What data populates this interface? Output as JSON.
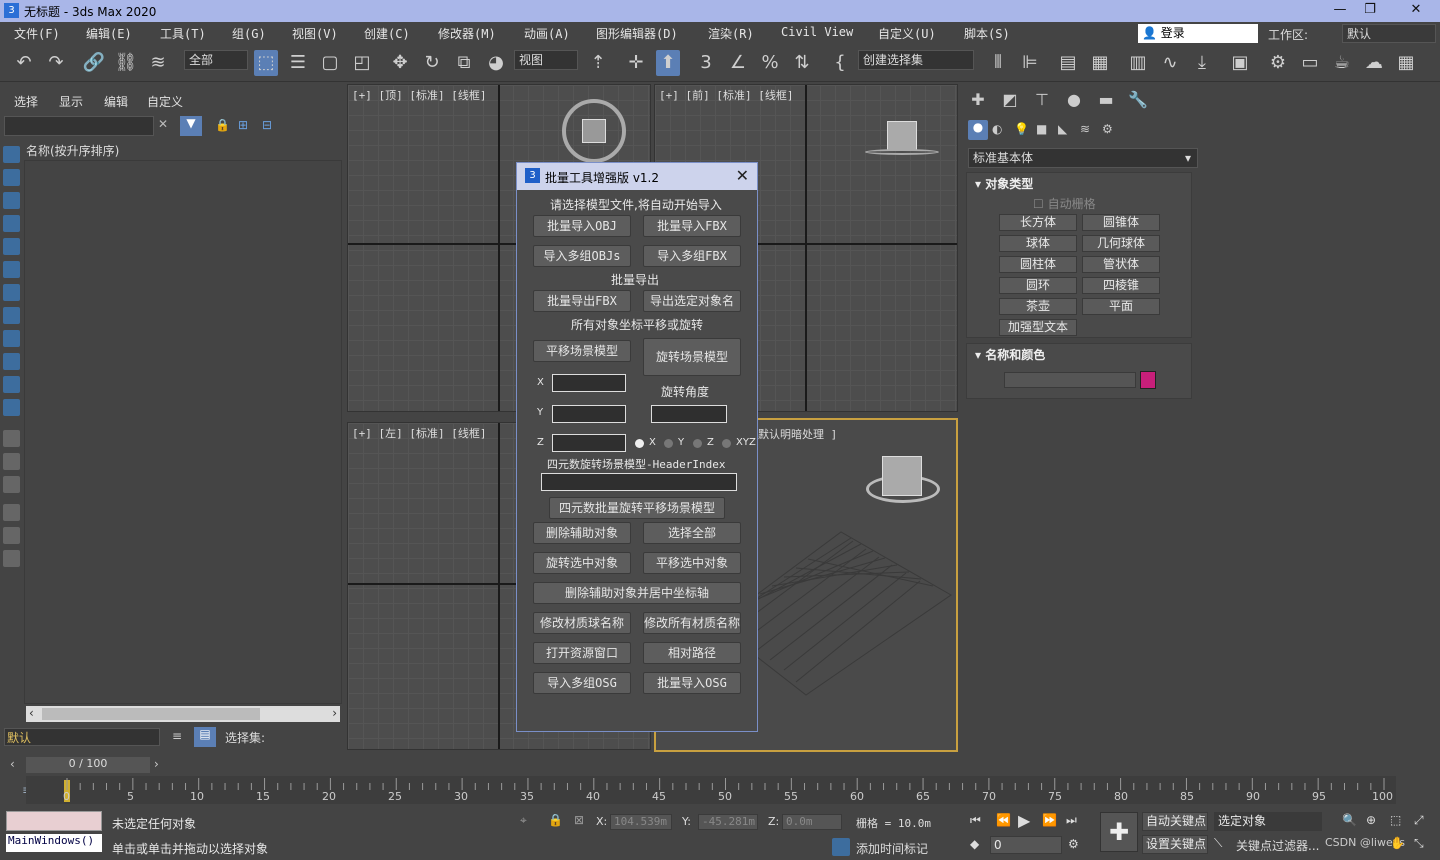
{
  "window": {
    "title": "无标题 - 3ds Max 2020",
    "min": "—",
    "max": "❐",
    "close": "✕"
  },
  "menu": [
    "文件(F)",
    "编辑(E)",
    "工具(T)",
    "组(G)",
    "视图(V)",
    "创建(C)",
    "修改器(M)",
    "动画(A)",
    "图形编辑器(D)",
    "渲染(R)",
    "Civil View",
    "自定义(U)",
    "脚本(S)"
  ],
  "login": "登录",
  "workspace": {
    "label": "工作区:",
    "value": "默认"
  },
  "toolbar": {
    "filter": "全部",
    "view": "视图",
    "selection_set": "创建选择集"
  },
  "scene_explorer": {
    "tabs": [
      "选择",
      "显示",
      "编辑",
      "自定义"
    ],
    "column_header": "名称(按升序排序)",
    "layer": "默认",
    "selection_set_label": "选择集:"
  },
  "viewports": {
    "top": "[+] [顶] [标准] [线框]",
    "front": "[+] [前] [标准] [线框]",
    "left": "[+] [左] [标准] [线框]",
    "persp": "默认明暗处理 ]"
  },
  "command_panel": {
    "primitive_type": "标准基本体",
    "object_type_title": "对象类型",
    "autogrid": "自动栅格",
    "buttons": [
      "长方体",
      "圆锥体",
      "球体",
      "几何球体",
      "圆柱体",
      "管状体",
      "圆环",
      "四棱锥",
      "茶壶",
      "平面",
      "加强型文本"
    ],
    "name_color_title": "名称和颜色",
    "object_color": "#c71f7a"
  },
  "dialog": {
    "title": "批量工具增强版 v1.2",
    "import_hint": "请选择模型文件,将自动开始导入",
    "batch_import_obj": "批量导入OBJ",
    "batch_import_fbx": "批量导入FBX",
    "import_multi_objs": "导入多组OBJs",
    "import_multi_fbx": "导入多组FBX",
    "export_title": "批量导出",
    "batch_export_fbx": "批量导出FBX",
    "export_selected_names": "导出选定对象名",
    "transform_title": "所有对象坐标平移或旋转",
    "translate_scene": "平移场景模型",
    "rotate_scene": "旋转场景模型",
    "x": "X",
    "y": "Y",
    "z": "Z",
    "rotation_angle": "旋转角度",
    "axis_x": "X",
    "axis_y": "Y",
    "axis_z": "Z",
    "axis_xyz": "XYZ",
    "quat_title": "四元数旋转场景模型-HeaderIndex",
    "quat_batch": "四元数批量旋转平移场景模型",
    "delete_helpers": "删除辅助对象",
    "select_all": "选择全部",
    "rotate_selected": "旋转选中对象",
    "translate_selected": "平移选中对象",
    "delete_helpers_center": "删除辅助对象并居中坐标轴",
    "rename_material_balls": "修改材质球名称",
    "rename_all_materials": "修改所有材质名称",
    "open_asset_window": "打开资源窗口",
    "relative_path": "相对路径",
    "import_multi_osg": "导入多组OSG",
    "batch_import_osg": "批量导入OSG"
  },
  "timeline": {
    "counter": "0 / 100",
    "ticks": [
      "0",
      "5",
      "10",
      "15",
      "20",
      "25",
      "30",
      "35",
      "40",
      "45",
      "50",
      "55",
      "60",
      "65",
      "70",
      "75",
      "80",
      "85",
      "90",
      "95",
      "100"
    ]
  },
  "status": {
    "maxscript": "MainWindows()",
    "line1": "未选定任何对象",
    "line2": "单击或单击并拖动以选择对象",
    "x_label": "X:",
    "x_value": "104.539m",
    "y_label": "Y:",
    "y_value": "-45.281m",
    "z_label": "Z:",
    "z_value": "0.0m",
    "grid": "栅格 = 10.0m",
    "add_time_tag": "添加时间标记",
    "auto_key": "自动关键点",
    "selected_object": "选定对象",
    "set_key": "设置关键点",
    "key_filters": "关键点过滤器...",
    "frame": "0",
    "watermark": "CSDN @liweys"
  }
}
